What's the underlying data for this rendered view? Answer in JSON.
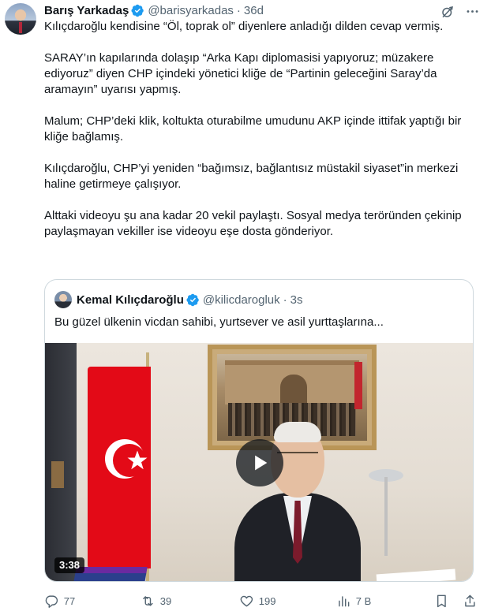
{
  "tweet": {
    "author_name": "Barış Yarkadaş",
    "author_handle": "@barisyarkadas",
    "separator": "·",
    "time": "36d",
    "paragraphs": [
      "Kılıçdaroğlu kendisine “Öl, toprak ol” diyenlere anladığı dilden cevap vermiş.",
      "SARAY’ın kapılarında dolaşıp “Arka Kapı diplomasisi yapıyoruz; müzakere ediyoruz” diyen CHP içindeki yönetici kliğe de “Partinin geleceğini Saray’da aramayın” uyarısı yapmış.",
      "Malum; CHP’deki klik, koltukta oturabilme umudunu AKP içinde ittifak yaptığı bir kliğe bağlamış.",
      "Kılıçdaroğlu, CHP’yi yeniden “bağımsız, bağlantısız müstakil siyaset”in merkezi haline getirmeye çalışıyor.",
      "Alttaki videoyu şu ana kadar 20 vekil paylaştı. Sosyal medya teröründen çekinip paylaşmayan vekiller ise videoyu eşe dosta gönderiyor."
    ]
  },
  "quote": {
    "author_name": "Kemal Kılıçdaroğlu",
    "author_handle": "@kilicdarogluk",
    "separator": "·",
    "time": "3s",
    "text": "Bu güzel ülkenin vicdan sahibi, yurtsever ve asil yurttaşlarına...",
    "video_duration": "3:38"
  },
  "actions": {
    "replies": "77",
    "reposts": "39",
    "likes": "199",
    "views": "7 B"
  },
  "icons": {
    "verified": "verified-badge-icon",
    "grok": "grok-icon",
    "more": "more-icon",
    "reply": "reply-icon",
    "repost": "repost-icon",
    "like": "heart-icon",
    "views": "views-icon",
    "bookmark": "bookmark-icon",
    "share": "share-icon",
    "play": "play-icon"
  },
  "colors": {
    "verified_blue": "#1d9bf0",
    "muted_text": "#536471",
    "border": "#cfd9de",
    "flag_red": "#e30a17"
  }
}
